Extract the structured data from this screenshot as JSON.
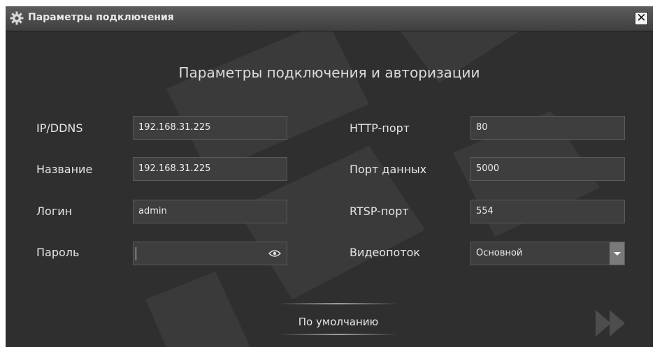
{
  "window": {
    "title": "Параметры подключения"
  },
  "heading": "Параметры подключения и авторизации",
  "fields": {
    "ip": {
      "label": "IP/DDNS",
      "value": "192.168.31.225"
    },
    "name": {
      "label": "Название",
      "value": "192.168.31.225"
    },
    "login": {
      "label": "Логин",
      "value": "admin"
    },
    "password": {
      "label": "Пароль",
      "value": ""
    },
    "http_port": {
      "label": "HTTP-порт",
      "value": "80"
    },
    "data_port": {
      "label": "Порт данных",
      "value": "5000"
    },
    "rtsp_port": {
      "label": "RTSP-порт",
      "value": "554"
    },
    "stream": {
      "label": "Видеопоток",
      "value": "Основной"
    }
  },
  "buttons": {
    "defaults": "По умолчанию",
    "close": "✕"
  },
  "icons": {
    "title": "gear-icon",
    "password_toggle": "eye-icon",
    "next": "fast-forward-icon",
    "dropdown": "chevron-down-icon"
  }
}
